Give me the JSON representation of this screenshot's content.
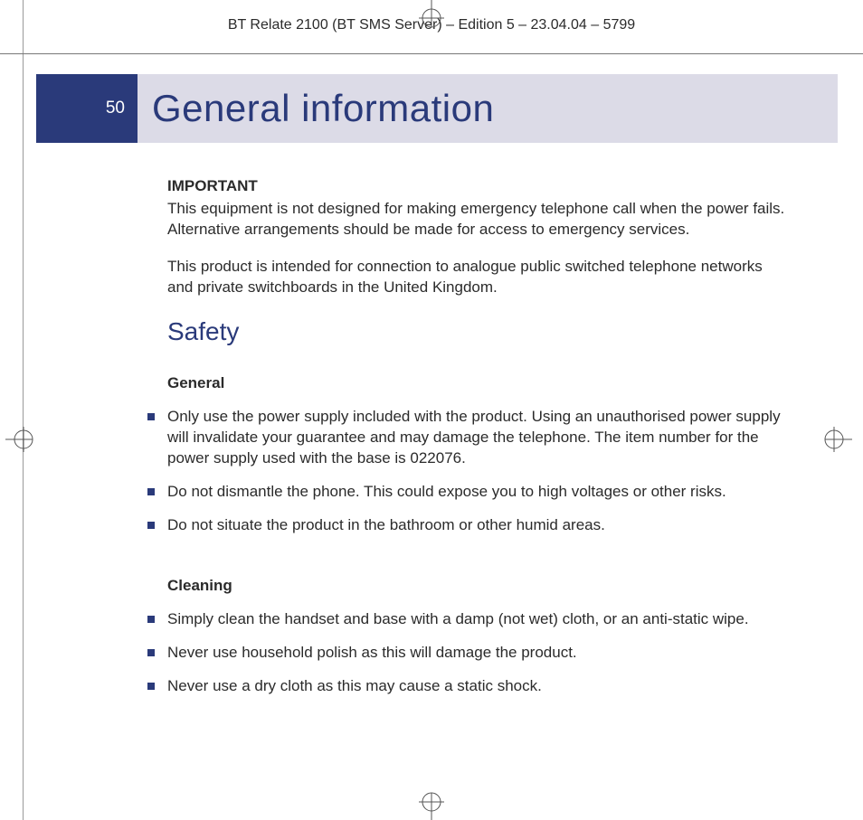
{
  "header_line": "BT Relate 2100 (BT SMS Server) – Edition 5 – 23.04.04 – 5799",
  "page_number": "50",
  "page_title": "General information",
  "important_label": "IMPORTANT",
  "important_p1": "This equipment is not designed for making emergency telephone call when the power fails. Alternative arrangements should be made for access to emergency services.",
  "important_p2": "This product is intended for connection to analogue public switched telephone networks and private switchboards in the United Kingdom.",
  "safety_heading": "Safety",
  "general_heading": "General",
  "general_bullets": [
    "Only use the power supply included with the product. Using an unauthorised power supply will invalidate your guarantee and may damage the telephone. The item number for the power supply used with the base is 022076.",
    "Do not dismantle the phone. This could expose you to high voltages or other risks.",
    "Do not situate the product in the bathroom or other humid areas."
  ],
  "cleaning_heading": "Cleaning",
  "cleaning_bullets": [
    "Simply clean the handset and base with a damp (not wet) cloth, or an anti-static wipe.",
    "Never use household polish as this will damage the product.",
    "Never use a dry cloth as this may cause a static shock."
  ]
}
